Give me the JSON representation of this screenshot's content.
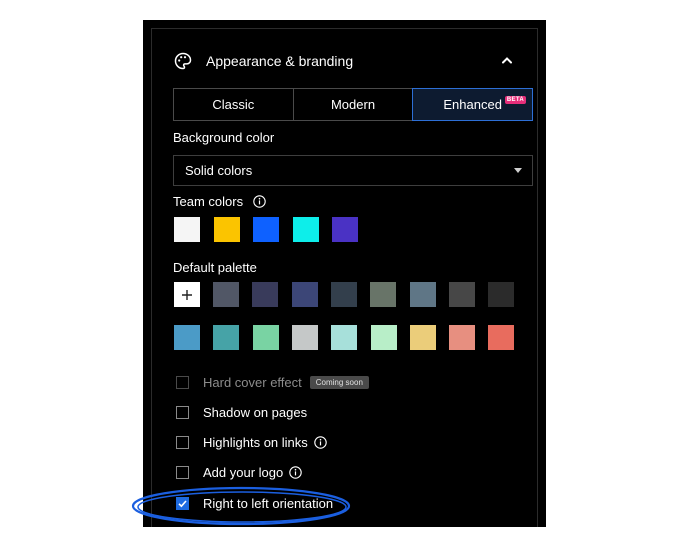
{
  "section": {
    "title": "Appearance & branding",
    "icon": "palette-icon",
    "collapse_icon": "chevron-up-icon"
  },
  "view_modes": {
    "options": [
      {
        "label": "Classic"
      },
      {
        "label": "Modern"
      },
      {
        "label": "Enhanced",
        "badge": "BETA"
      }
    ],
    "selected": "Enhanced"
  },
  "background": {
    "label": "Background color",
    "value": "Solid colors"
  },
  "team_colors": {
    "label": "Team colors",
    "colors": [
      "#f5f5f5",
      "#fbc400",
      "#0e61ff",
      "#0deeea",
      "#4a32c4"
    ]
  },
  "default_palette": {
    "label": "Default palette",
    "add_icon": "plus-icon",
    "row1": [
      "#515766",
      "#393b5b",
      "#3c4677",
      "#333f4c",
      "#687468",
      "#5f7686",
      "#474747",
      "#2b2b2b"
    ],
    "row2": [
      "#4b9bc7",
      "#46a3a7",
      "#79d3a3",
      "#c5c8c8",
      "#a7e0da",
      "#b8eec8",
      "#ebcd7a",
      "#e78f80",
      "#e86c5e"
    ]
  },
  "options": [
    {
      "label": "Hard cover effect",
      "checked": false,
      "disabled": true,
      "tag": "Coming soon"
    },
    {
      "label": "Shadow on pages",
      "checked": false
    },
    {
      "label": "Highlights on links",
      "checked": false,
      "info": true
    },
    {
      "label": "Add your logo",
      "checked": false,
      "info": true
    },
    {
      "label": "Right to left orientation",
      "checked": true
    }
  ],
  "highlight_color": "#1b5fe0"
}
